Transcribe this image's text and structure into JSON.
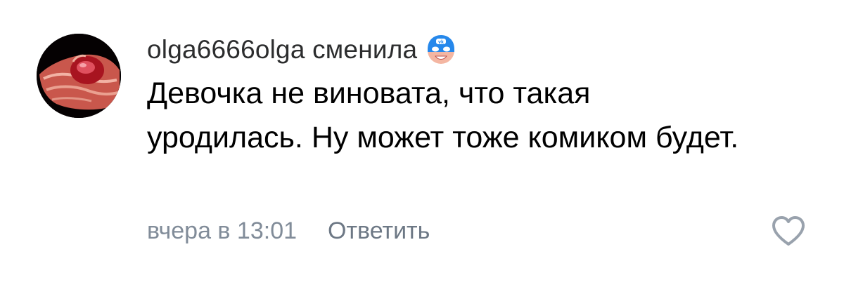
{
  "comment": {
    "author": "olga6666olga сменила",
    "status_icon": "masked-hero-face-emoji",
    "avatar_icon": "hands-holding-red-heart",
    "text": "Девочка не виновата, что такая уродилась. Ну может тоже комиком будет.",
    "timestamp": "вчера в 13:01",
    "reply_label": "Ответить",
    "like_icon": "heart-outline-icon"
  },
  "colors": {
    "author": "#2c2d2e",
    "text": "#000000",
    "meta": "#818c99",
    "reply": "#6d7885",
    "icon": "#99a2ad",
    "status_mask": "#2688eb"
  }
}
